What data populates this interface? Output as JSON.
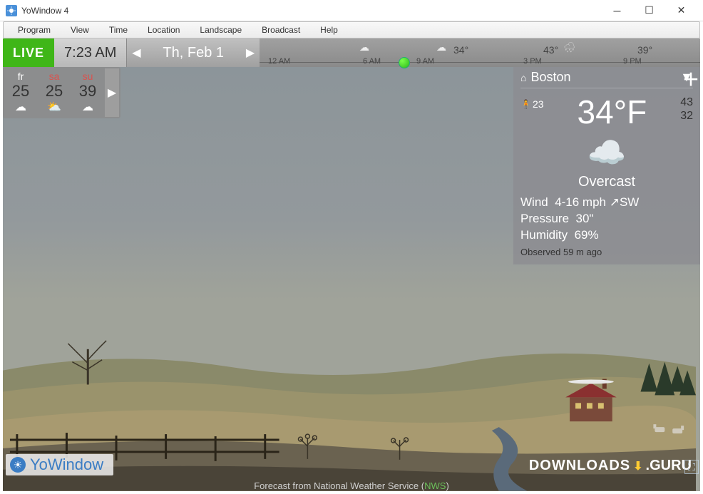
{
  "window": {
    "title": "YoWindow 4"
  },
  "menu": {
    "program": "Program",
    "view": "View",
    "time": "Time",
    "location": "Location",
    "landscape": "Landscape",
    "broadcast": "Broadcast",
    "help": "Help"
  },
  "toolbar": {
    "live": "LIVE",
    "clock": "7:23 AM",
    "date": "Th, Feb 1"
  },
  "timeline": {
    "ticks": {
      "t0": "12 AM",
      "t1": "6 AM",
      "t2": "9 AM",
      "t3": "3 PM",
      "t4": "9 PM"
    },
    "points": {
      "p1_temp": "34°",
      "p2_temp": "43°",
      "p3_temp": "39°"
    }
  },
  "forecast": [
    {
      "day": "fr",
      "temp": "25",
      "icon": "cloud",
      "weekend": false
    },
    {
      "day": "sa",
      "temp": "25",
      "icon": "partly",
      "weekend": true
    },
    {
      "day": "su",
      "temp": "39",
      "icon": "cloud",
      "weekend": true
    }
  ],
  "panel": {
    "location": "Boston",
    "feels_like": "23",
    "temp": "34°F",
    "high": "43",
    "low": "32",
    "condition": "Overcast",
    "wind_label": "Wind",
    "wind_value": "4-16 mph ↗SW",
    "pressure_label": "Pressure",
    "pressure_value": "30\"",
    "humidity_label": "Humidity",
    "humidity_value": "69%",
    "observed": "Observed 59 m ago"
  },
  "branding": {
    "app": "YoWindow",
    "downloads": "DOWNLOADS",
    "guru": ".GURU"
  },
  "footer": {
    "prefix": "Forecast from National Weather Service (",
    "nws": "NWS",
    "suffix": ")"
  }
}
